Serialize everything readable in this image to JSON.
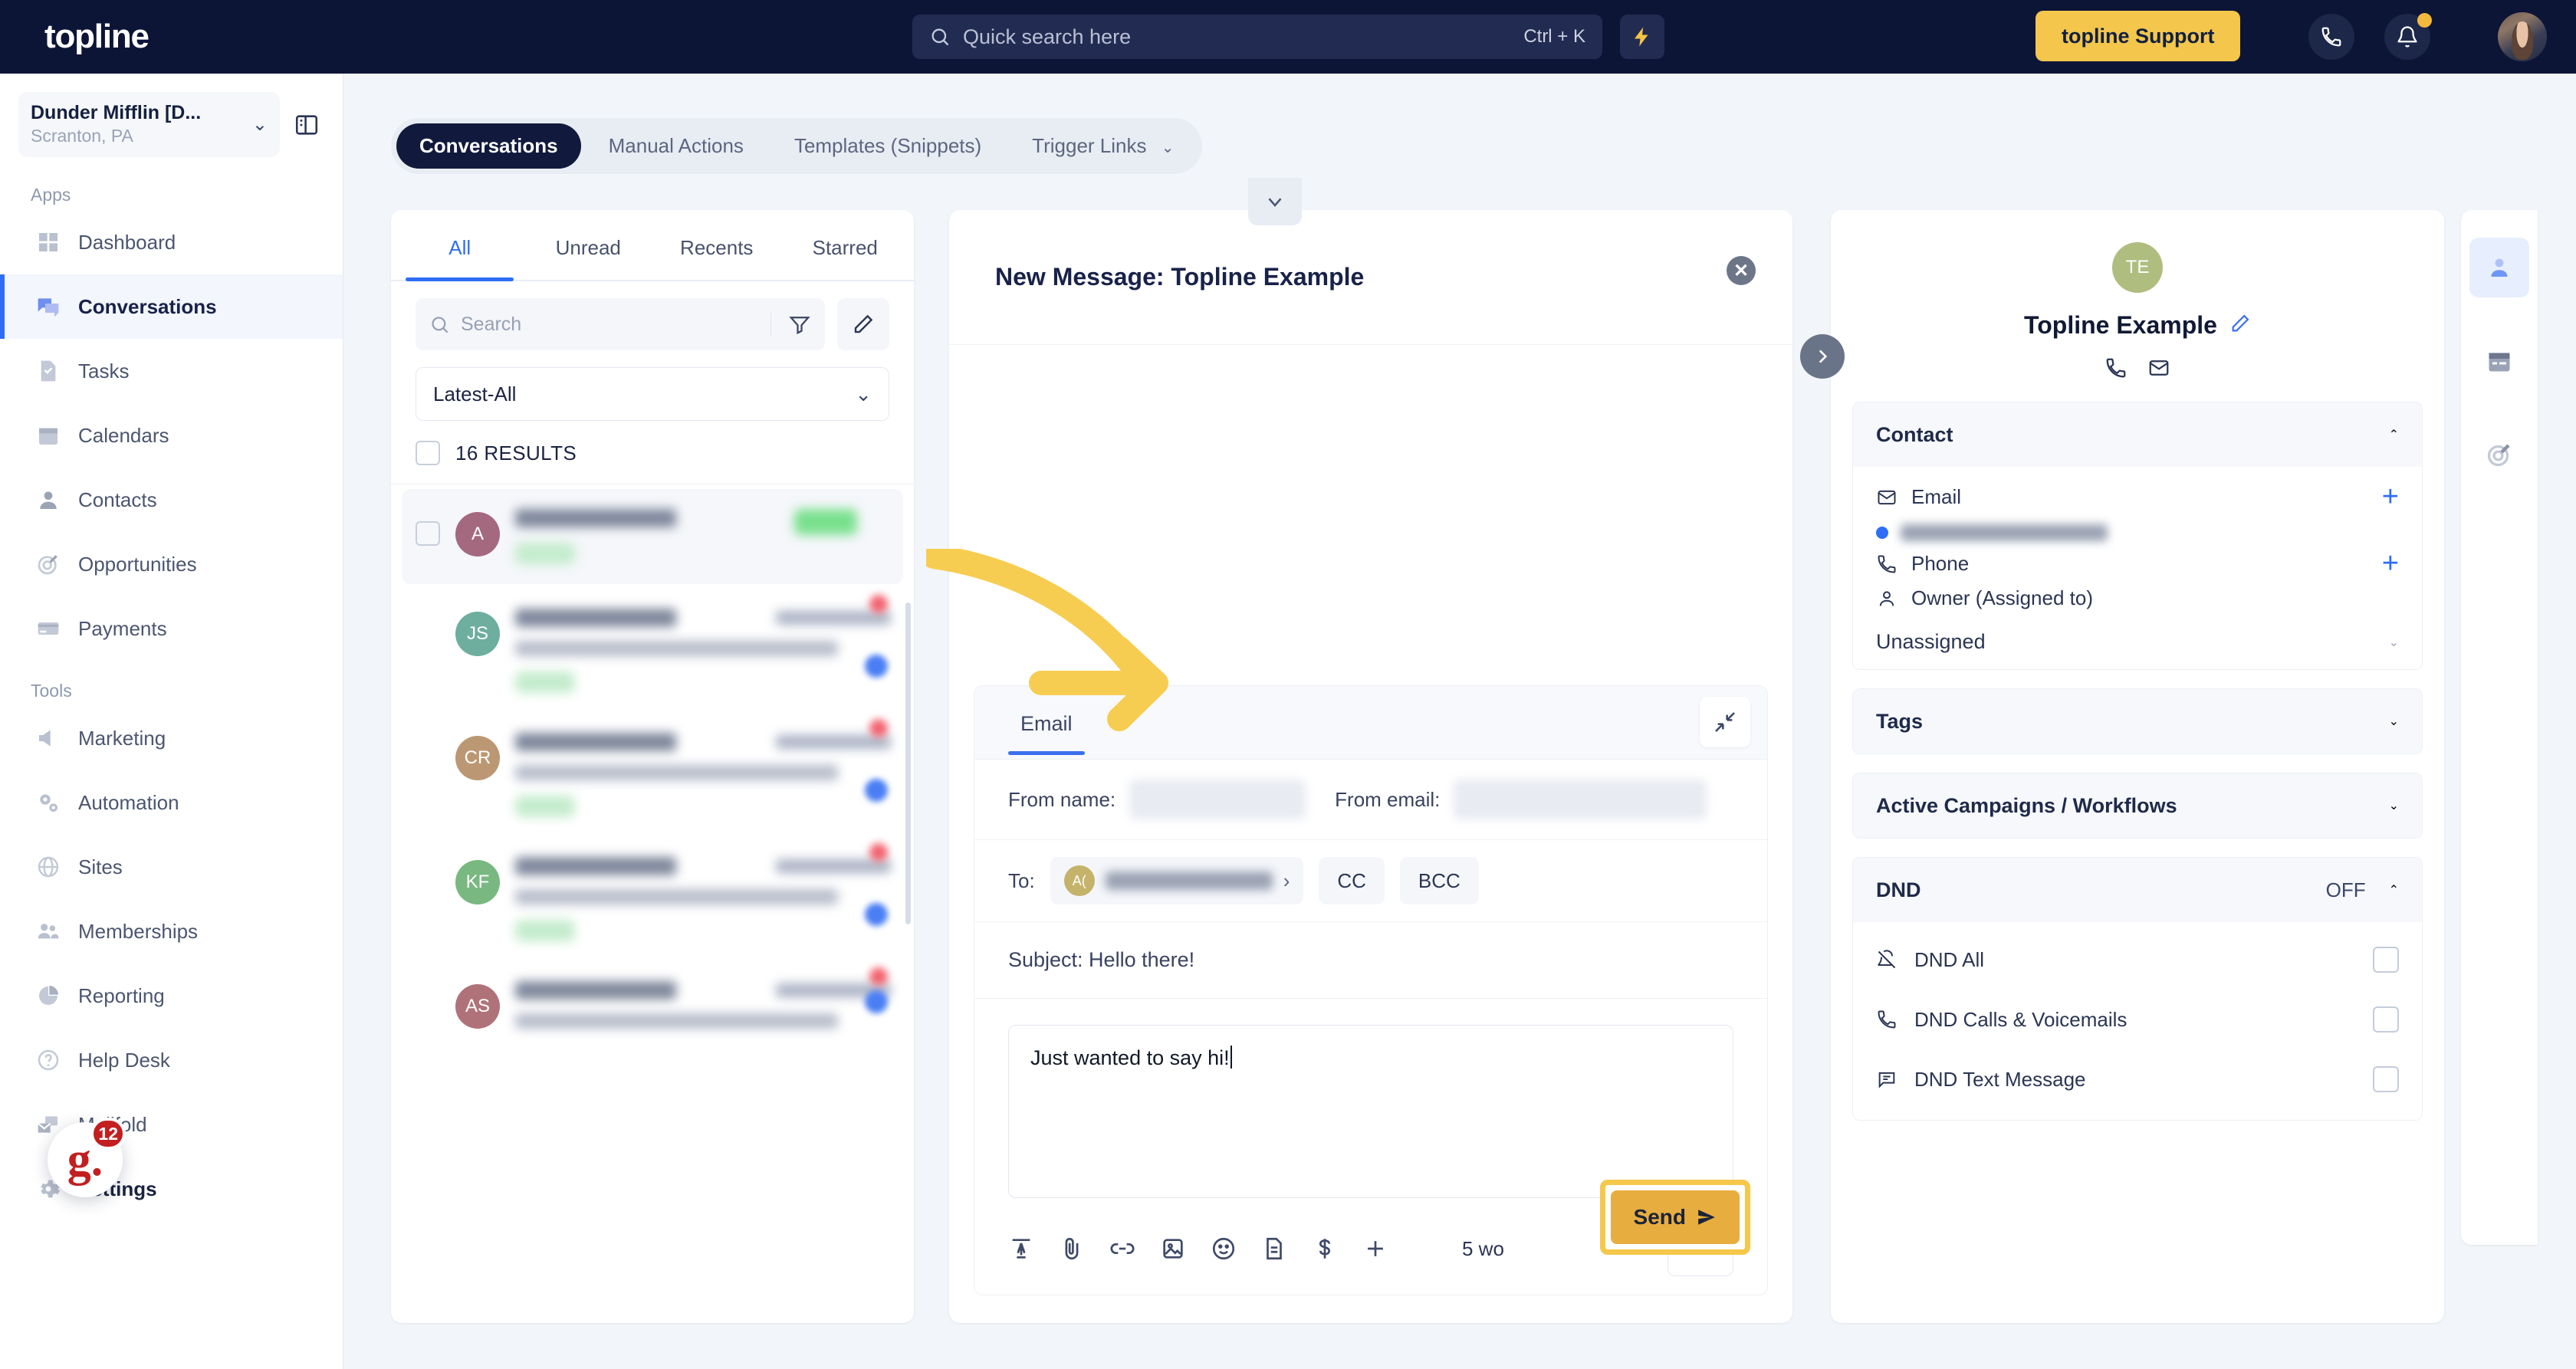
{
  "topbar": {
    "logo": "topline",
    "search_placeholder": "Quick search here",
    "search_shortcut": "Ctrl + K",
    "bolt_icon": "lightning-bolt-icon",
    "support_label": "topline Support",
    "phone_icon": "phone-icon",
    "bell_icon": "bell-icon",
    "avatar_icon": "user-avatar"
  },
  "sidebar": {
    "location_name": "Dunder Mifflin [D...",
    "location_sub": "Scranton, PA",
    "panel_toggle_icon": "panel-toggle-icon",
    "group_apps": "Apps",
    "group_tools": "Tools",
    "apps": [
      {
        "label": "Dashboard",
        "icon": "dashboard-icon"
      },
      {
        "label": "Conversations",
        "icon": "conversations-icon"
      },
      {
        "label": "Tasks",
        "icon": "tasks-icon"
      },
      {
        "label": "Calendars",
        "icon": "calendar-icon"
      },
      {
        "label": "Contacts",
        "icon": "contacts-icon"
      },
      {
        "label": "Opportunities",
        "icon": "opportunities-icon"
      },
      {
        "label": "Payments",
        "icon": "payments-icon"
      }
    ],
    "tools": [
      {
        "label": "Marketing",
        "icon": "megaphone-icon"
      },
      {
        "label": "Automation",
        "icon": "gears-icon"
      },
      {
        "label": "Sites",
        "icon": "globe-icon"
      },
      {
        "label": "Memberships",
        "icon": "members-icon"
      },
      {
        "label": "Reporting",
        "icon": "pie-chart-icon"
      },
      {
        "label": "Help Desk",
        "icon": "question-circle-icon"
      },
      {
        "label": "Mailfold",
        "icon": "mail-stack-icon"
      },
      {
        "label": "Settings",
        "icon": "gear-icon"
      }
    ],
    "chat_widget": {
      "glyph": "g.",
      "badge": "12"
    }
  },
  "segmented_tabs": [
    {
      "label": "Conversations",
      "active": true
    },
    {
      "label": "Manual Actions",
      "active": false
    },
    {
      "label": "Templates (Snippets)",
      "active": false
    },
    {
      "label": "Trigger Links",
      "active": false,
      "has_chevron": true
    }
  ],
  "conversation_list": {
    "tabs": [
      "All",
      "Unread",
      "Recents",
      "Starred"
    ],
    "active_tab": "All",
    "search_placeholder": "Search",
    "filter_icon": "filter-icon",
    "compose_icon": "pencil-icon",
    "sort_value": "Latest-All",
    "results_label": "16 RESULTS",
    "rows": [
      {
        "initials": "A",
        "color": "#a4687f",
        "selected": true
      },
      {
        "initials": "JS",
        "color": "#6dae9e",
        "selected": false
      },
      {
        "initials": "CR",
        "color": "#bb9873",
        "selected": false
      },
      {
        "initials": "KF",
        "color": "#79b880",
        "selected": false
      },
      {
        "initials": "AS",
        "color": "#b07279",
        "selected": false
      }
    ]
  },
  "compose": {
    "title": "New Message: Topline Example",
    "collapse_icon": "chevron-down-icon",
    "close_icon": "close-icon",
    "tab_label": "Email",
    "expand_icon": "collapse-arrows-icon",
    "from_name_label": "From name:",
    "from_email_label": "From email:",
    "to_label": "To:",
    "to_initials": "A(",
    "cc_label": "CC",
    "bcc_label": "BCC",
    "subject": "Subject: Hello there!",
    "body": "Just wanted to say hi!",
    "word_count": "5 wo",
    "send_label": "Send",
    "toolbar_icons": [
      "text-format-icon",
      "paperclip-icon",
      "link-icon",
      "image-icon",
      "emoji-icon",
      "document-icon",
      "dollar-icon",
      "plus-icon"
    ]
  },
  "contact_panel": {
    "expand_icon": "chevron-right-icon",
    "avatar_initials": "TE",
    "name": "Topline Example",
    "edit_icon": "pencil-edit-icon",
    "call_icon": "phone-icon",
    "email_icon": "envelope-icon",
    "sections": {
      "contact": {
        "title": "Contact",
        "email_label": "Email",
        "phone_label": "Phone",
        "owner_label": "Owner (Assigned to)",
        "owner_value": "Unassigned"
      },
      "tags": {
        "title": "Tags"
      },
      "campaigns": {
        "title": "Active Campaigns / Workflows"
      },
      "dnd": {
        "title": "DND",
        "state": "OFF",
        "rows": [
          {
            "label": "DND All",
            "icon": "bell-off-icon",
            "checked": false
          },
          {
            "label": "DND Calls & Voicemails",
            "icon": "phone-icon",
            "checked": false
          },
          {
            "label": "DND Text Message",
            "icon": "chat-bubble-icon",
            "checked": false
          }
        ]
      }
    }
  },
  "rail": [
    {
      "icon": "person-icon",
      "active": true
    },
    {
      "icon": "calendar-icon",
      "active": false
    },
    {
      "icon": "target-icon",
      "active": false
    }
  ],
  "colors": {
    "brand_navy": "#0d1537",
    "accent_gold": "#f4c64c",
    "accent_blue": "#2f6df6",
    "send_gold": "#e8ad3f"
  }
}
